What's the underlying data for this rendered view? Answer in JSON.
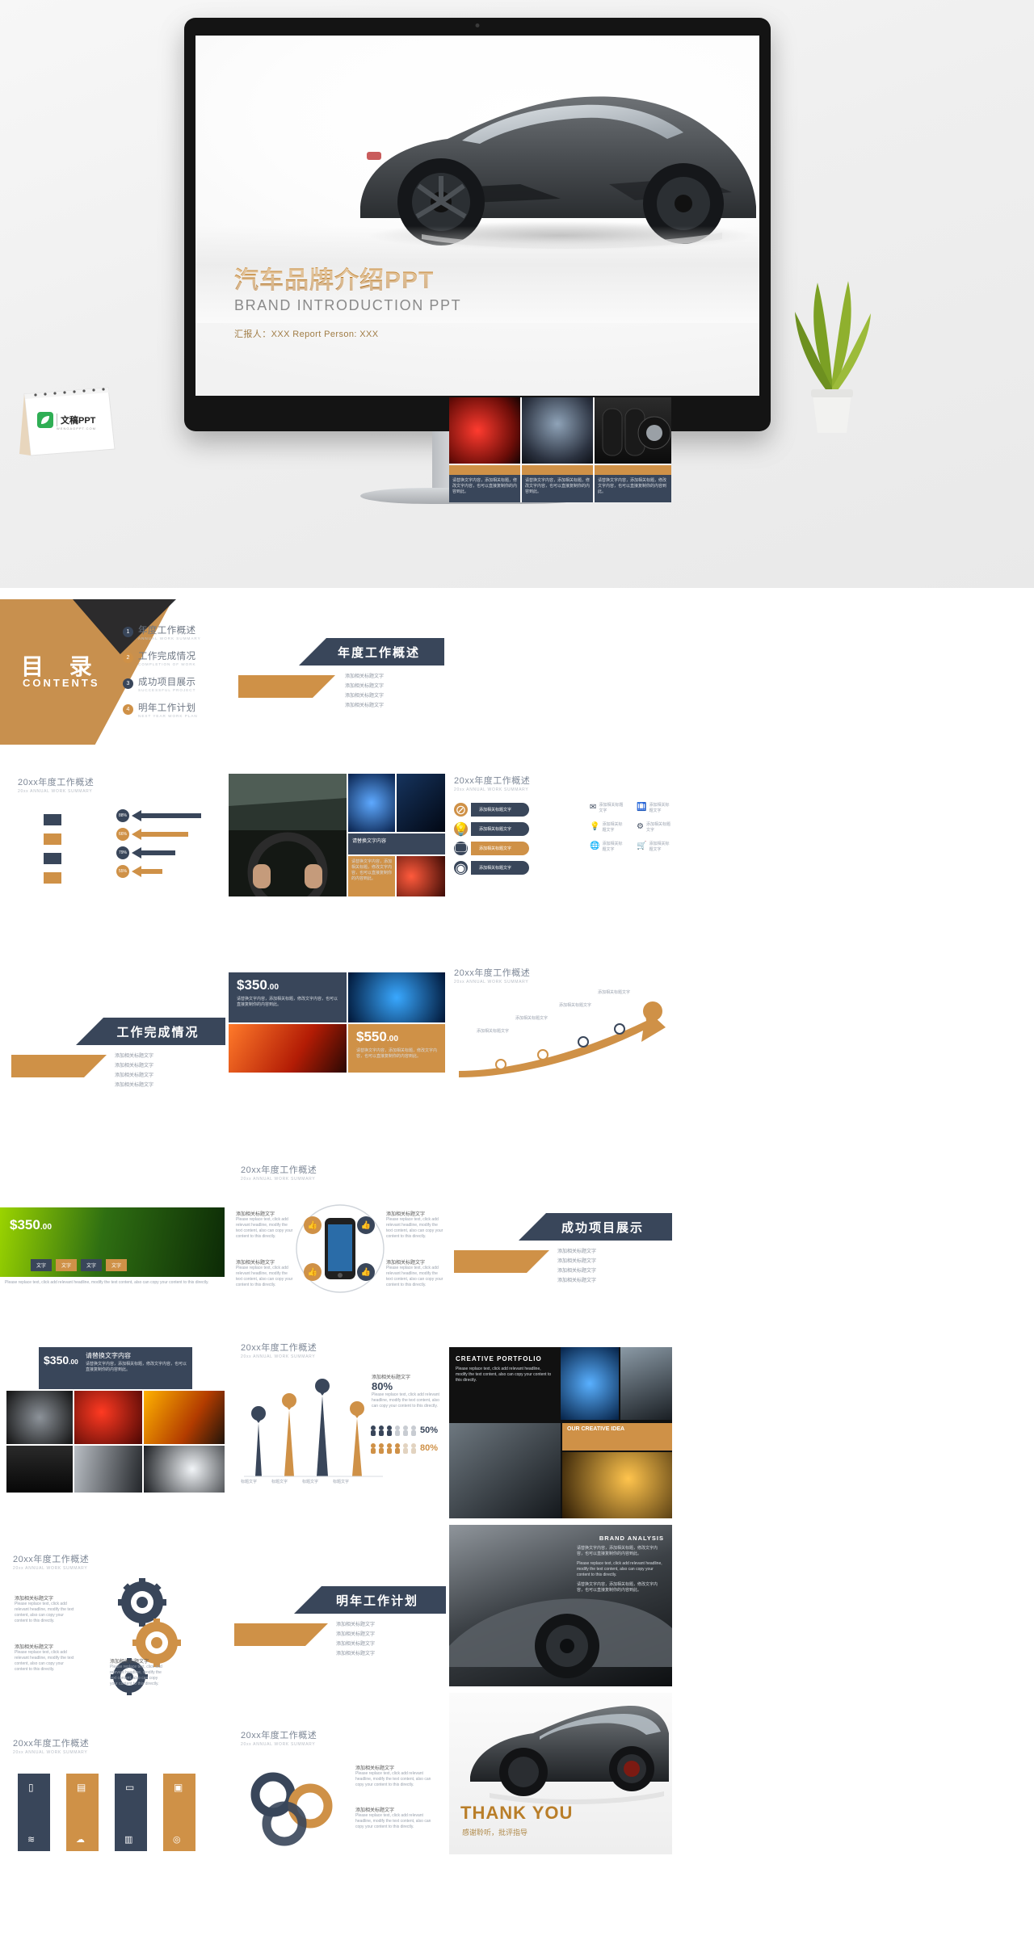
{
  "hero": {
    "slide_title_cn": "汽车品牌介绍PPT",
    "slide_title_en": "BRAND INTRODUCTION PPT",
    "reporter": "汇报人：XXX   Report Person: XXX",
    "logo_text": "文稿PPT",
    "logo_sub": "WENGAOPPT.COM"
  },
  "colors": {
    "gold": "#cf9147",
    "gold_dark": "#b9761f",
    "navy": "#39465a",
    "navy_dark": "#24262a",
    "gray_text": "#7d8796"
  },
  "toc": {
    "title_cn": "目  录",
    "title_en": "CONTENTS",
    "items": [
      {
        "num": "1",
        "cn": "年度工作概述",
        "en": "ANNUAL WORK SUMMARY",
        "color": "#39465a"
      },
      {
        "num": "2",
        "cn": "工作完成情况",
        "en": "COMPLETION OF WORK",
        "color": "#cf9147"
      },
      {
        "num": "3",
        "cn": "成功项目展示",
        "en": "SUCCESSFUL PROJECT",
        "color": "#39465a"
      },
      {
        "num": "4",
        "cn": "明年工作计划",
        "en": "NEXT YEAR WORK PLAN",
        "color": "#cf9147"
      }
    ]
  },
  "section_banners": [
    {
      "title": "年度工作概述",
      "bullets": [
        "添加相关标题文字",
        "添加相关标题文字",
        "添加相关标题文字",
        "添加相关标题文字"
      ]
    },
    {
      "title": "工作完成情况",
      "bullets": [
        "添加相关标题文字",
        "添加相关标题文字",
        "添加相关标题文字",
        "添加相关标题文字"
      ]
    },
    {
      "title": "成功项目展示",
      "bullets": [
        "添加相关标题文字",
        "添加相关标题文字",
        "添加相关标题文字",
        "添加相关标题文字"
      ]
    },
    {
      "title": "明年工作计划",
      "bullets": [
        "添加相关标题文字",
        "添加相关标题文字",
        "添加相关标题文字",
        "添加相关标题文字"
      ]
    }
  ],
  "slide_caption": {
    "cn": "20xx年度工作概述",
    "en": "20xx ANNUAL WORK SUMMARY"
  },
  "common": {
    "placeholder_title": "请替换文字内容",
    "placeholder_title2": "添加相关标题文字",
    "placeholder_body": "请替换文字内容，添加相关标题，修改文字内容，也可以直接复制你的内容到此。",
    "placeholder_en": "Please replace text, click add relevant headline, modify the text content, also can copy your content to this directly.",
    "creative_portfolio": "CREATIVE PORTFOLIO",
    "our_creative_idea": "OUR CREATIVE IDEA",
    "brand_analysis": "BRAND ANALYSIS"
  },
  "prices": [
    {
      "dollars": "$350",
      "cents": ".00"
    },
    {
      "dollars": "$550",
      "cents": ".00"
    },
    {
      "dollars": "$350",
      "cents": ".00"
    },
    {
      "dollars": "$350",
      "cents": ".00"
    }
  ],
  "chart_data": {
    "type": "bar",
    "title": "20xx年度工作概述",
    "categories": [
      "标题文字",
      "标题文字",
      "标题文字",
      "标题文字"
    ],
    "values": [
      55,
      75,
      90,
      62
    ],
    "labels": [
      "80%",
      "50%",
      "80%"
    ],
    "xlabel": "",
    "ylabel": "",
    "ylim": [
      0,
      100
    ]
  },
  "percent_rows": [
    {
      "value": "88%"
    },
    {
      "value": "66%"
    },
    {
      "value": "79%"
    },
    {
      "value": "55%"
    }
  ],
  "text_tabs": [
    "文字",
    "文字",
    "文字",
    "文字"
  ],
  "thank_you": {
    "en": "THANK YOU",
    "cn": "感谢聆听，批评指导"
  }
}
